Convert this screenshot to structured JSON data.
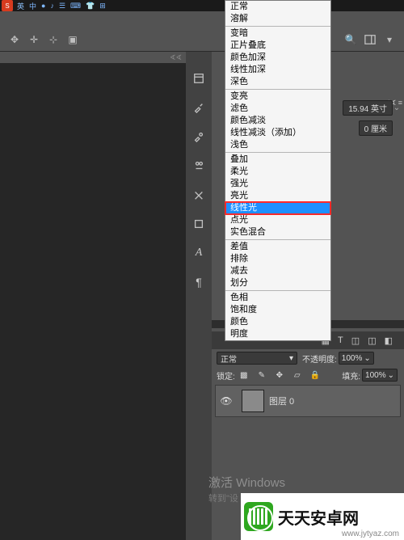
{
  "ime": {
    "lang": "英",
    "items": [
      "中",
      "●",
      "♪",
      "☰",
      "⌨",
      "👕",
      "⊞"
    ]
  },
  "toolbar": {
    "search": "🔍"
  },
  "blend": {
    "normal": "正常",
    "dissolve": "溶解",
    "darken": "变暗",
    "multiply": "正片叠底",
    "color_burn": "颜色加深",
    "linear_burn": "线性加深",
    "darker_color": "深色",
    "lighten": "变亮",
    "screen": "滤色",
    "color_dodge": "颜色减淡",
    "linear_dodge": "线性减淡（添加）",
    "lighter_color": "浅色",
    "overlay": "叠加",
    "soft_light": "柔光",
    "hard_light": "强光",
    "vivid_light": "亮光",
    "linear_light": "线性光",
    "pin_light": "点光",
    "hard_mix": "实色混合",
    "difference": "差值",
    "exclusion": "排除",
    "subtract": "减去",
    "divide": "划分",
    "hue": "色相",
    "saturation": "饱和度",
    "color": "颜色",
    "luminosity": "明度"
  },
  "properties": {
    "dim1": "15.94 英寸",
    "dim2": "0 厘米"
  },
  "layers": {
    "mode_selected": "正常",
    "opacity_label": "不透明度:",
    "opacity_value": "100%",
    "fill_label": "填充:",
    "fill_value": "100%",
    "lock_label": "锁定:",
    "layer_name": "图层 0"
  },
  "watermark": {
    "l1": "激活 Windows",
    "l2": "转到\"设"
  },
  "brand": {
    "name": "天天安卓网",
    "url": "www.jytyaz.com"
  }
}
